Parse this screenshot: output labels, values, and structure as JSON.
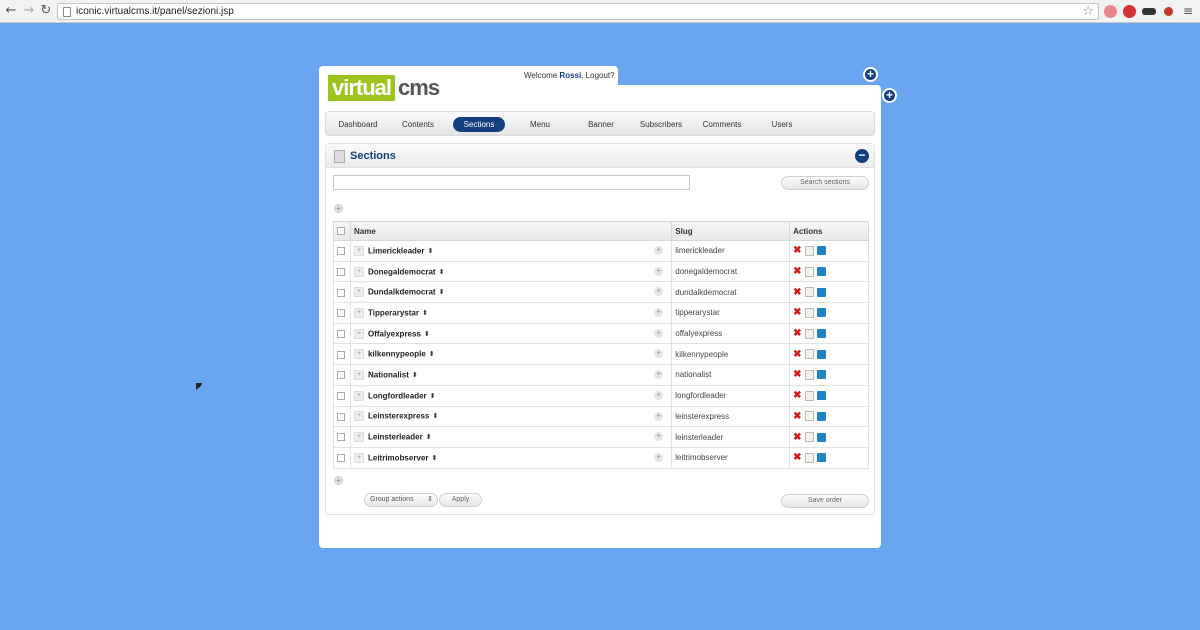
{
  "browser": {
    "url": "iconic.virtualcms.it/panel/sezioni.jsp"
  },
  "header": {
    "logo_part1": "virtual",
    "logo_part2": "cms",
    "welcome_prefix": "Welcome ",
    "user_name": "Rossi",
    "logout_label": ", Logout?"
  },
  "tabs": [
    {
      "label": "Dashboard"
    },
    {
      "label": "Contents"
    },
    {
      "label": "Sections"
    },
    {
      "label": "Menu"
    },
    {
      "label": "Banner"
    },
    {
      "label": "Subscribers"
    },
    {
      "label": "Comments"
    },
    {
      "label": "Users"
    }
  ],
  "section": {
    "title": "Sections",
    "search_button": "Search sections",
    "search_placeholder": ""
  },
  "table": {
    "headers": {
      "name": "Name",
      "slug": "Slug",
      "actions": "Actions"
    },
    "rows": [
      {
        "name": "Limerickleader",
        "slug": "limerickleader"
      },
      {
        "name": "Donegaldemocrat",
        "slug": "donegaldemocrat"
      },
      {
        "name": "Dundalkdemocrat",
        "slug": "dundalkdemocrat"
      },
      {
        "name": "Tipperarystar",
        "slug": "tipperarystar"
      },
      {
        "name": "Offalyexpress",
        "slug": "offalyexpress"
      },
      {
        "name": "kilkennypeople",
        "slug": "kilkennypeople"
      },
      {
        "name": "Nationalist",
        "slug": "nationalist"
      },
      {
        "name": "Longfordleader",
        "slug": "longfordleader"
      },
      {
        "name": "Leinsterexpress",
        "slug": "leinsterexpress"
      },
      {
        "name": "Leinsterleader",
        "slug": "leinsterleader"
      },
      {
        "name": "Leitrimobserver",
        "slug": "leitrimobserver"
      }
    ]
  },
  "footer": {
    "group_actions": "Group actions",
    "apply": "Apply",
    "save_order": "Save order"
  },
  "colors": {
    "background": "#6aa5f2",
    "brand_green": "#9dc41d",
    "brand_navy": "#123f7f",
    "delete_red": "#d31b1b"
  }
}
